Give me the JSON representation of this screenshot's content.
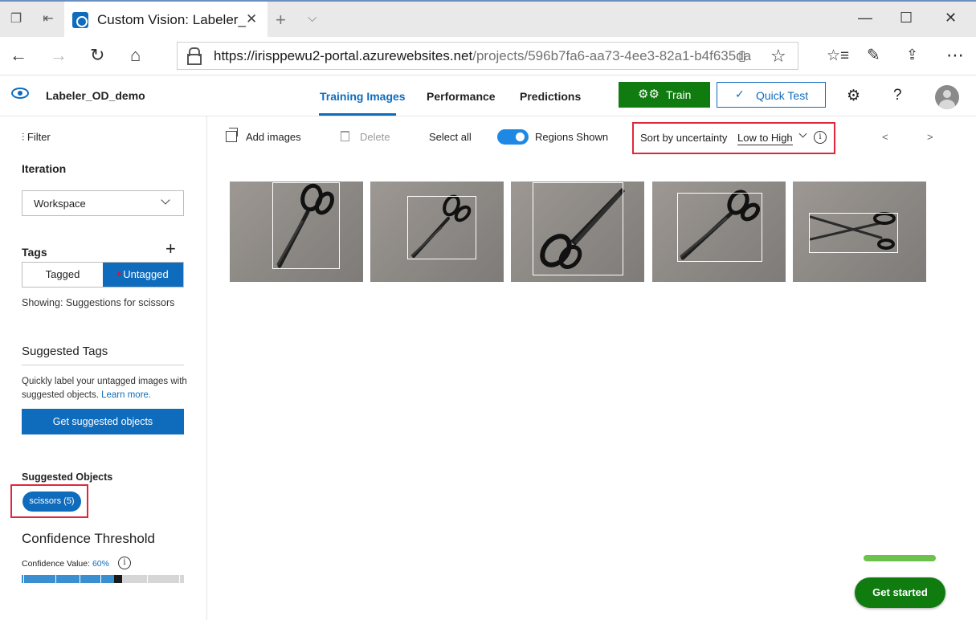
{
  "browser": {
    "tab_title": "Custom Vision: Labeler_",
    "tab_close": "✕",
    "new_tab": "+",
    "url_host": "https://irisppewu2-portal.azurewebsites.net",
    "url_path": "/projects/596b7fa6-aa73-4ee3-82a1-b4f635da"
  },
  "app": {
    "project_name": "Labeler_OD_demo",
    "nav_tabs": [
      {
        "label": "Training Images",
        "active": true
      },
      {
        "label": "Performance",
        "active": false
      },
      {
        "label": "Predictions",
        "active": false
      }
    ],
    "train_label": "Train",
    "quick_test_label": "Quick Test",
    "help": "?"
  },
  "sidebar": {
    "filter_label": "Filter",
    "iteration_label": "Iteration",
    "iteration_value": "Workspace",
    "tags_label": "Tags",
    "tag_filters": [
      "Tagged",
      "Untagged"
    ],
    "selected_tag_filter": "Untagged",
    "showing_text": "Showing: Suggestions for scissors",
    "suggested_tags_title": "Suggested Tags",
    "suggested_tags_desc": "Quickly label your untagged images with suggested objects.",
    "learn_more": "Learn more.",
    "get_suggested_button": "Get suggested objects",
    "suggested_objects_title": "Suggested Objects",
    "suggested_object_chip": "scissors (5)",
    "confidence_title": "Confidence Threshold",
    "confidence_value_label": "Confidence Value:",
    "confidence_value": "60%",
    "confidence_fraction": 0.6
  },
  "toolbar": {
    "add_images": "Add images",
    "delete": "Delete",
    "select_all": "Select all",
    "regions_shown": "Regions Shown",
    "regions_toggle_on": true,
    "sort_label": "Sort by uncertainty",
    "sort_value": "Low to High",
    "prev": "<",
    "next": ">"
  },
  "images": [
    {
      "name": "scissors-image-1"
    },
    {
      "name": "scissors-image-2"
    },
    {
      "name": "scissors-image-3"
    },
    {
      "name": "scissors-image-4"
    },
    {
      "name": "scissors-image-5"
    }
  ],
  "get_started_label": "Get started",
  "colors": {
    "accent": "#0f6cbd",
    "train_green": "#107c10",
    "highlight_red": "#e0263c"
  }
}
